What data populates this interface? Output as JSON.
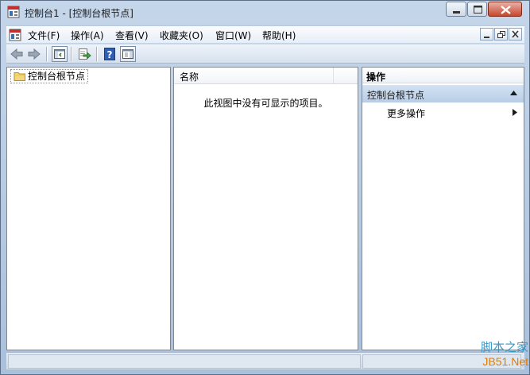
{
  "window": {
    "title": "控制台1 - [控制台根节点]"
  },
  "menubar": {
    "items": [
      "文件(F)",
      "操作(A)",
      "查看(V)",
      "收藏夹(O)",
      "窗口(W)",
      "帮助(H)"
    ]
  },
  "toolbar": {
    "buttons": [
      "back-icon",
      "forward-icon",
      "show-hide-tree-icon",
      "export-list-icon",
      "help-icon",
      "show-hide-action-pane-icon"
    ]
  },
  "tree": {
    "root_label": "控制台根节点"
  },
  "list": {
    "column_name": "名称",
    "empty_message": "此视图中没有可显示的项目。"
  },
  "actions": {
    "header": "操作",
    "section_title": "控制台根节点",
    "more_actions": "更多操作"
  },
  "watermark": {
    "top": "脚本之家",
    "bottom": "JB51.Net"
  },
  "colors": {
    "window_frame": "#a9c0dc",
    "action_section": "#b8cde6",
    "close_button": "#c7472d"
  }
}
